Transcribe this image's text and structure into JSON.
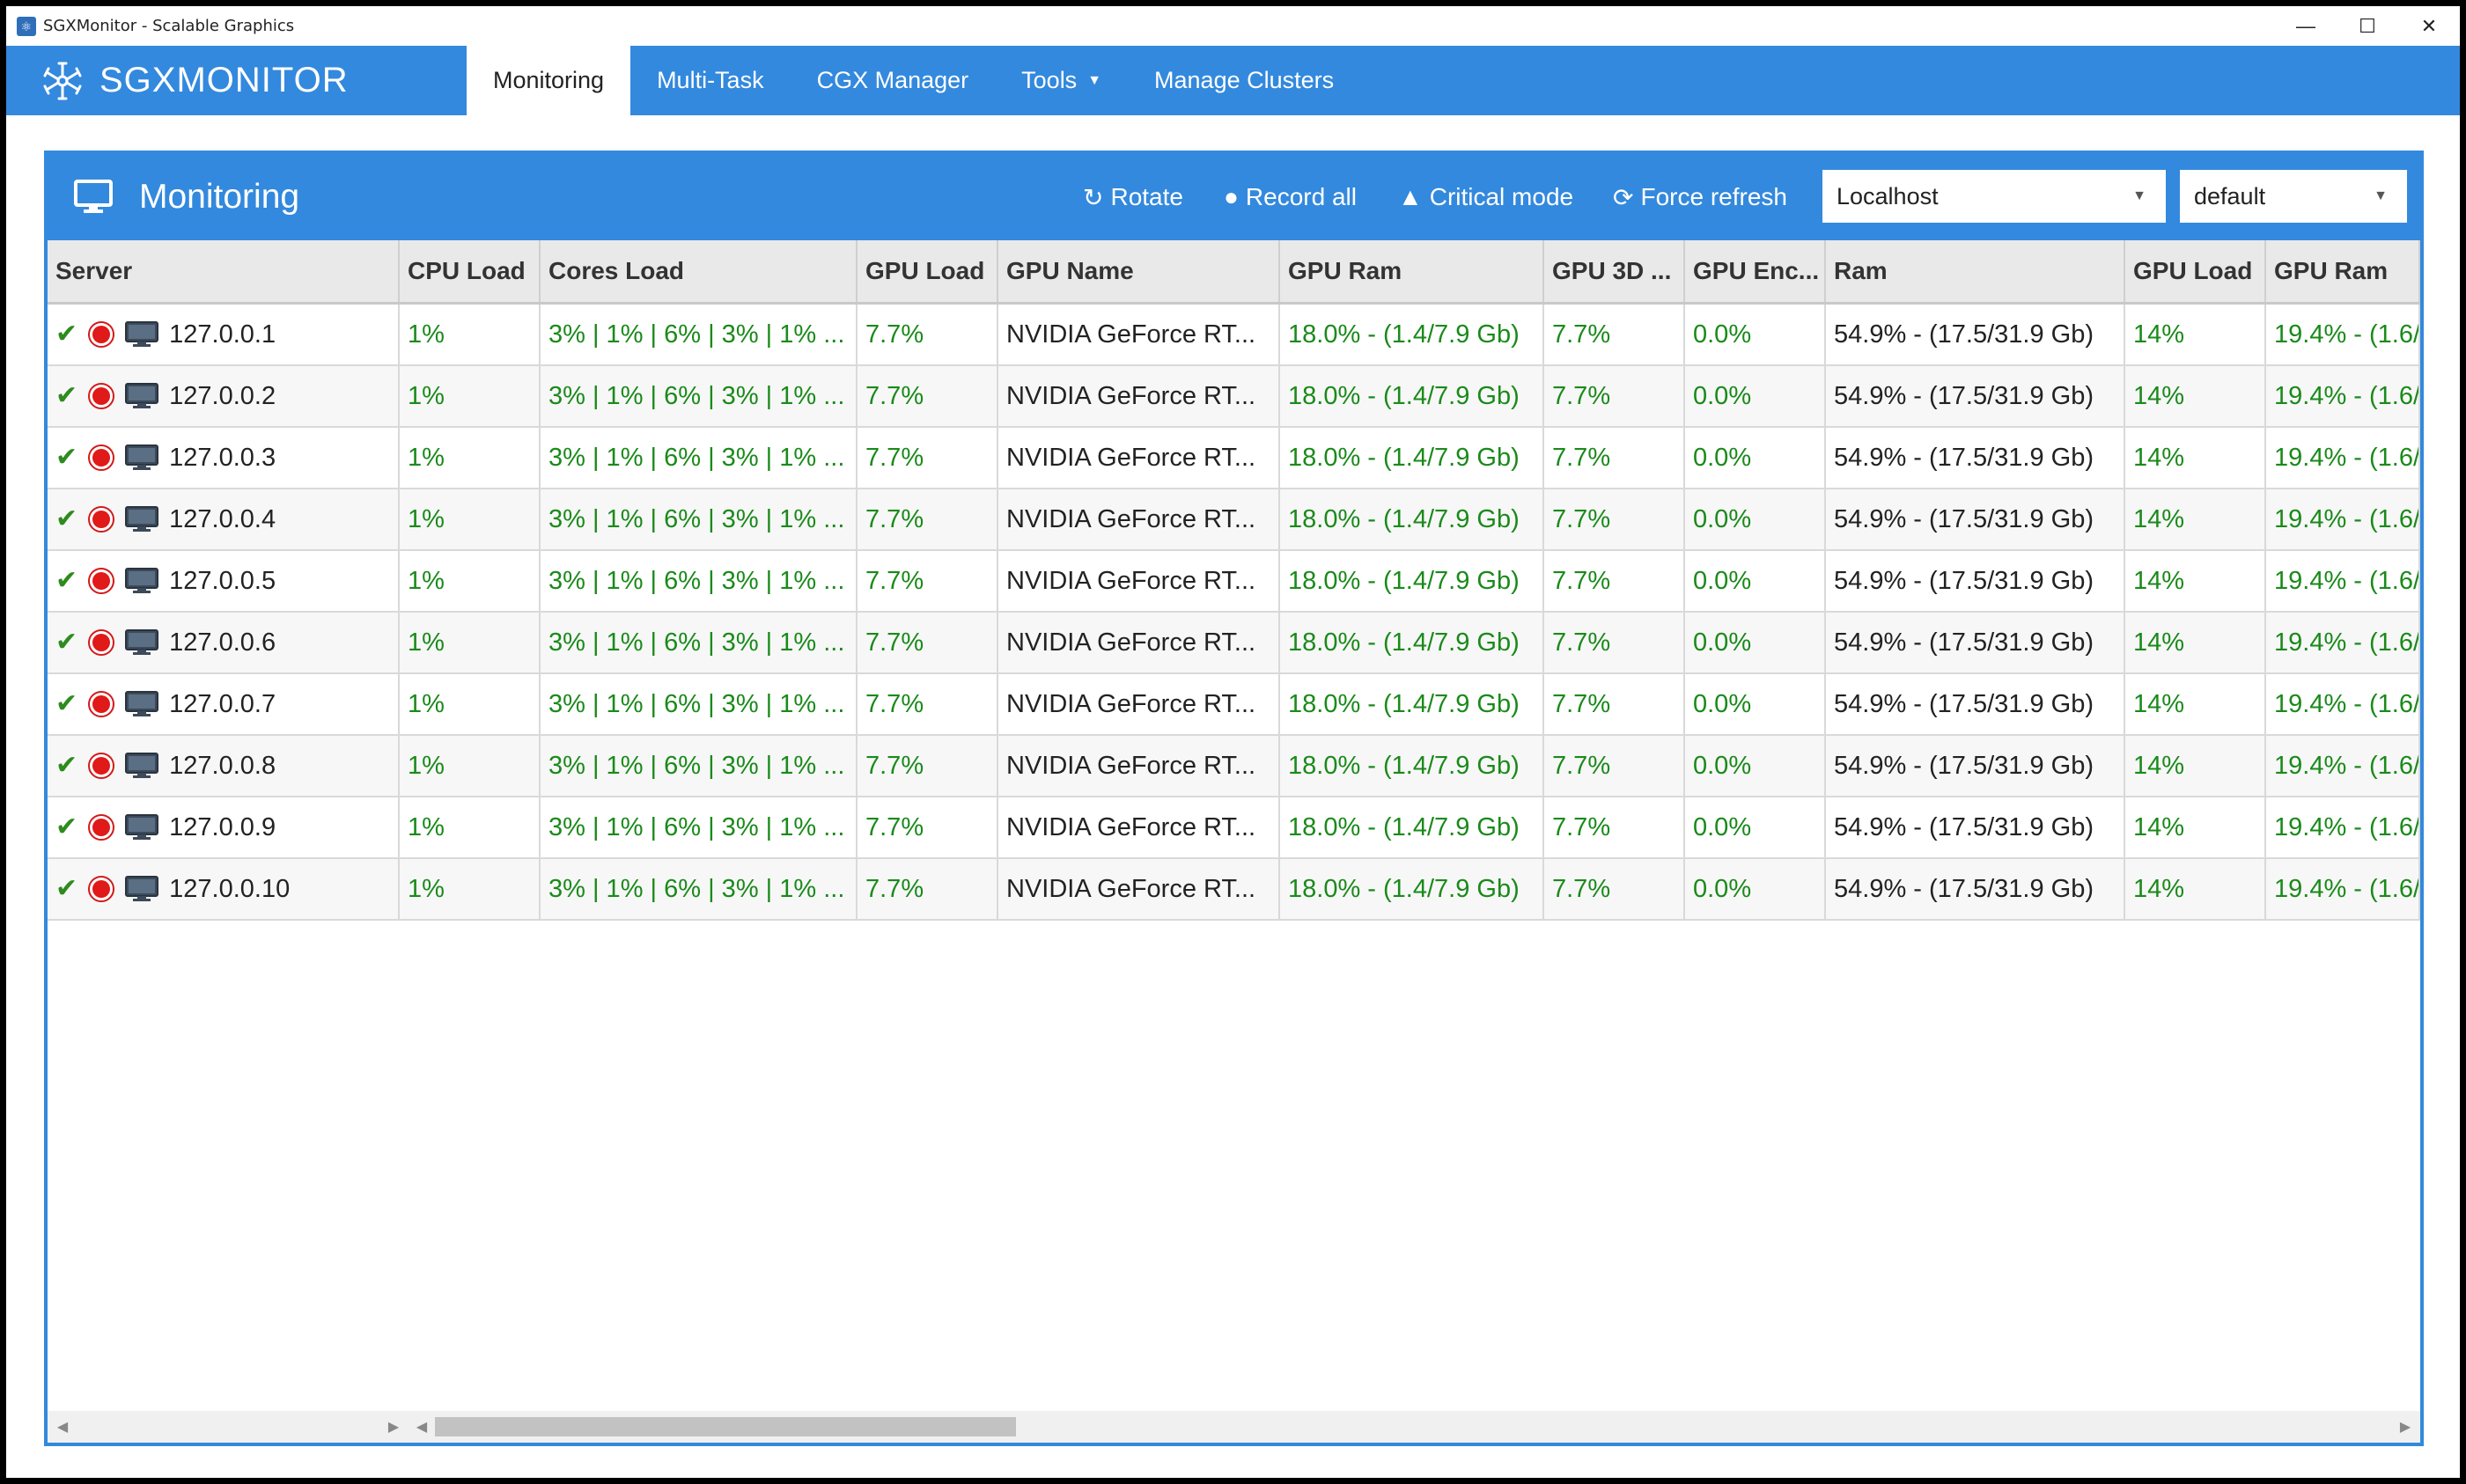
{
  "window": {
    "title": "SGXMonitor - Scalable Graphics",
    "controls": {
      "minimize": "—",
      "maximize": "☐",
      "close": "✕"
    }
  },
  "nav": {
    "brand": "SGXMONITOR",
    "tabs": [
      {
        "label": "Monitoring",
        "active": true
      },
      {
        "label": "Multi-Task"
      },
      {
        "label": "CGX Manager"
      },
      {
        "label": "Tools"
      },
      {
        "label": "Manage Clusters"
      }
    ]
  },
  "panel": {
    "title": "Monitoring",
    "actions": {
      "rotate": "Rotate",
      "record_all": "Record all",
      "critical_mode": "Critical mode",
      "force_refresh": "Force refresh"
    },
    "host_select": "Localhost",
    "profile_select": "default"
  },
  "table": {
    "headers": {
      "server": "Server",
      "cpu_load": "CPU Load",
      "cores_load": "Cores Load",
      "gpu_load": "GPU Load",
      "gpu_name": "GPU Name",
      "gpu_ram": "GPU Ram",
      "gpu_3d": "GPU 3D ...",
      "gpu_enc": "GPU Enc...",
      "ram": "Ram",
      "gpu_load2": "GPU Load",
      "gpu_ram2": "GPU Ram"
    },
    "rows": [
      {
        "server": "127.0.0.1",
        "cpu": "1%",
        "cores": "3% | 1% | 6% | 3% | 1% ...",
        "gpu_load": "7.7%",
        "gpu_name": "NVIDIA GeForce RT...",
        "gpu_ram": "18.0% - (1.4/7.9 Gb)",
        "gpu_3d": "7.7%",
        "gpu_enc": "0.0%",
        "ram": "54.9% - (17.5/31.9 Gb)",
        "gpu_load2": "14%",
        "gpu_ram2": "19.4% - (1.6/"
      },
      {
        "server": "127.0.0.2",
        "cpu": "1%",
        "cores": "3% | 1% | 6% | 3% | 1% ...",
        "gpu_load": "7.7%",
        "gpu_name": "NVIDIA GeForce RT...",
        "gpu_ram": "18.0% - (1.4/7.9 Gb)",
        "gpu_3d": "7.7%",
        "gpu_enc": "0.0%",
        "ram": "54.9% - (17.5/31.9 Gb)",
        "gpu_load2": "14%",
        "gpu_ram2": "19.4% - (1.6/"
      },
      {
        "server": "127.0.0.3",
        "cpu": "1%",
        "cores": "3% | 1% | 6% | 3% | 1% ...",
        "gpu_load": "7.7%",
        "gpu_name": "NVIDIA GeForce RT...",
        "gpu_ram": "18.0% - (1.4/7.9 Gb)",
        "gpu_3d": "7.7%",
        "gpu_enc": "0.0%",
        "ram": "54.9% - (17.5/31.9 Gb)",
        "gpu_load2": "14%",
        "gpu_ram2": "19.4% - (1.6/"
      },
      {
        "server": "127.0.0.4",
        "cpu": "1%",
        "cores": "3% | 1% | 6% | 3% | 1% ...",
        "gpu_load": "7.7%",
        "gpu_name": "NVIDIA GeForce RT...",
        "gpu_ram": "18.0% - (1.4/7.9 Gb)",
        "gpu_3d": "7.7%",
        "gpu_enc": "0.0%",
        "ram": "54.9% - (17.5/31.9 Gb)",
        "gpu_load2": "14%",
        "gpu_ram2": "19.4% - (1.6/"
      },
      {
        "server": "127.0.0.5",
        "cpu": "1%",
        "cores": "3% | 1% | 6% | 3% | 1% ...",
        "gpu_load": "7.7%",
        "gpu_name": "NVIDIA GeForce RT...",
        "gpu_ram": "18.0% - (1.4/7.9 Gb)",
        "gpu_3d": "7.7%",
        "gpu_enc": "0.0%",
        "ram": "54.9% - (17.5/31.9 Gb)",
        "gpu_load2": "14%",
        "gpu_ram2": "19.4% - (1.6/"
      },
      {
        "server": "127.0.0.6",
        "cpu": "1%",
        "cores": "3% | 1% | 6% | 3% | 1% ...",
        "gpu_load": "7.7%",
        "gpu_name": "NVIDIA GeForce RT...",
        "gpu_ram": "18.0% - (1.4/7.9 Gb)",
        "gpu_3d": "7.7%",
        "gpu_enc": "0.0%",
        "ram": "54.9% - (17.5/31.9 Gb)",
        "gpu_load2": "14%",
        "gpu_ram2": "19.4% - (1.6/"
      },
      {
        "server": "127.0.0.7",
        "cpu": "1%",
        "cores": "3% | 1% | 6% | 3% | 1% ...",
        "gpu_load": "7.7%",
        "gpu_name": "NVIDIA GeForce RT...",
        "gpu_ram": "18.0% - (1.4/7.9 Gb)",
        "gpu_3d": "7.7%",
        "gpu_enc": "0.0%",
        "ram": "54.9% - (17.5/31.9 Gb)",
        "gpu_load2": "14%",
        "gpu_ram2": "19.4% - (1.6/"
      },
      {
        "server": "127.0.0.8",
        "cpu": "1%",
        "cores": "3% | 1% | 6% | 3% | 1% ...",
        "gpu_load": "7.7%",
        "gpu_name": "NVIDIA GeForce RT...",
        "gpu_ram": "18.0% - (1.4/7.9 Gb)",
        "gpu_3d": "7.7%",
        "gpu_enc": "0.0%",
        "ram": "54.9% - (17.5/31.9 Gb)",
        "gpu_load2": "14%",
        "gpu_ram2": "19.4% - (1.6/"
      },
      {
        "server": "127.0.0.9",
        "cpu": "1%",
        "cores": "3% | 1% | 6% | 3% | 1% ...",
        "gpu_load": "7.7%",
        "gpu_name": "NVIDIA GeForce RT...",
        "gpu_ram": "18.0% - (1.4/7.9 Gb)",
        "gpu_3d": "7.7%",
        "gpu_enc": "0.0%",
        "ram": "54.9% - (17.5/31.9 Gb)",
        "gpu_load2": "14%",
        "gpu_ram2": "19.4% - (1.6/"
      },
      {
        "server": "127.0.0.10",
        "cpu": "1%",
        "cores": "3% | 1% | 6% | 3% | 1% ...",
        "gpu_load": "7.7%",
        "gpu_name": "NVIDIA GeForce RT...",
        "gpu_ram": "18.0% - (1.4/7.9 Gb)",
        "gpu_3d": "7.7%",
        "gpu_enc": "0.0%",
        "ram": "54.9% - (17.5/31.9 Gb)",
        "gpu_load2": "14%",
        "gpu_ram2": "19.4% - (1.6/"
      }
    ]
  },
  "colors": {
    "accent": "#3389dd",
    "value_green": "#1a8a1a",
    "record_red": "#e01919"
  }
}
